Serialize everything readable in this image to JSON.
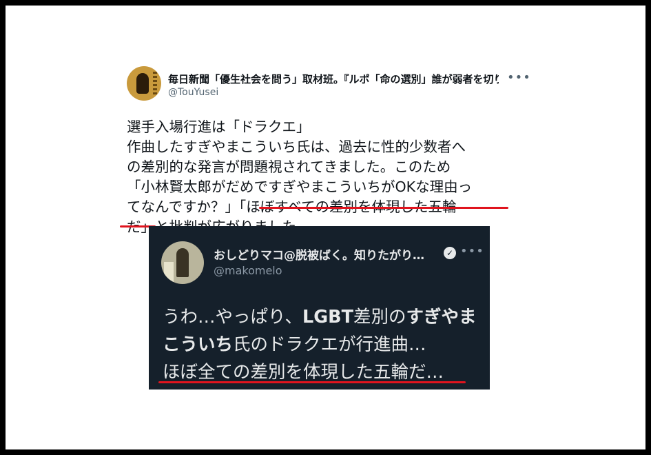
{
  "tweet": {
    "display_name": "毎日新聞「優生社会を問う」取材班。『ルポ「命の選別」誰が弱者を切り捨てるのか？』",
    "handle": "@TouYusei",
    "more_icon": "ellipsis-icon",
    "body_lines": [
      "選手入場行進は「ドラクエ」",
      "作曲したすぎやまこういち氏は、過去に性的少数者へ",
      "の差別的な発言が問題視されてきました。このため",
      "「小林賢太郎がだめですぎやまこういちがOKな理由っ",
      "てなんですか？」「ほぼすべての差別を体現した五輪",
      "だ」と批判が広がりました。"
    ]
  },
  "quote": {
    "display_name": "おしどりマコ@脱被ばく。知りたがり…",
    "handle": "@makomelo",
    "verified_icon": "verified-badge-icon",
    "text": {
      "line1_a": "うわ…やっぱり、",
      "line1_b": "LGBT",
      "line1_c": "差別の",
      "line1_d": "すぎやま",
      "line2_a": "こういち",
      "line2_b": "氏のドラクエが行進曲…",
      "line3": "ほぼ全ての差別を体現した五輪だ…"
    }
  },
  "colors": {
    "highlight_underline": "#e0141e",
    "quote_background": "#15202b"
  }
}
